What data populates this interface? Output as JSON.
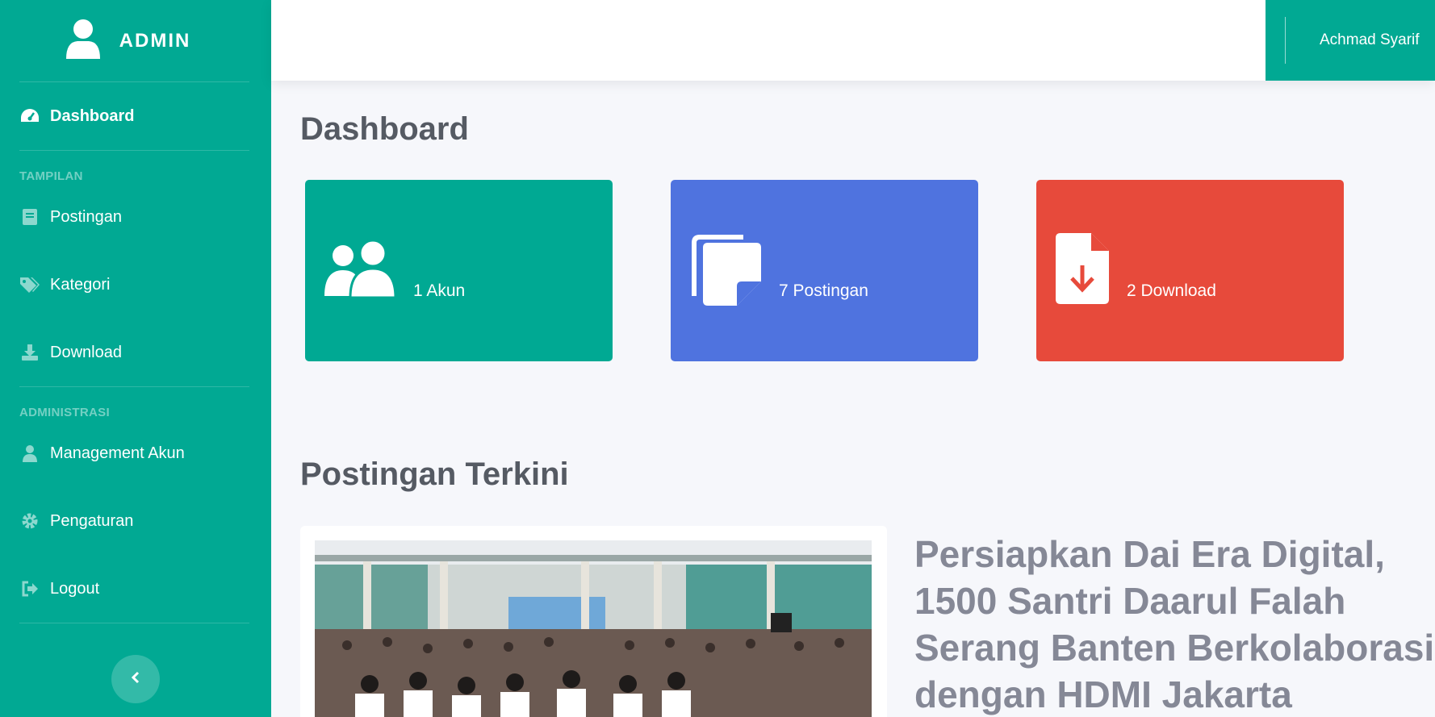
{
  "sidebar": {
    "brand": "ADMIN",
    "items": [
      {
        "label": "Dashboard",
        "icon": "dashboard-gauge-icon"
      },
      {
        "label": "Postingan",
        "icon": "book-icon"
      },
      {
        "label": "Kategori",
        "icon": "tags-icon"
      },
      {
        "label": "Download",
        "icon": "download-icon"
      },
      {
        "label": "Management Akun",
        "icon": "user-icon"
      },
      {
        "label": "Pengaturan",
        "icon": "gear-icon"
      },
      {
        "label": "Logout",
        "icon": "sign-out-icon"
      }
    ],
    "headings": [
      "TAMPILAN",
      "ADMINISTRASI"
    ],
    "toggle_icon": "chevron-left-icon"
  },
  "topbar": {
    "user_name": "Achmad Syarif"
  },
  "main": {
    "title": "Dashboard",
    "cards": [
      {
        "label": "1 Akun",
        "icon": "users-icon",
        "color": "#00a993"
      },
      {
        "label": "7 Postingan",
        "icon": "copy-icon",
        "color": "#4f73df"
      },
      {
        "label": "2 Download",
        "icon": "file-download-icon",
        "color": "#e74a3b"
      }
    ],
    "recent_title": "Postingan Terkini",
    "recent_post": {
      "title_lines": [
        "Persiapkan Dai Era Digital,",
        "1500 Santri Daarul Falah",
        "Serang Banten Berkolaborasi",
        "dengan HDMI Jakarta"
      ]
    }
  },
  "colors": {
    "sidebar": "#01a993",
    "background": "#f6f7fb",
    "heading_text": "#555a63"
  }
}
